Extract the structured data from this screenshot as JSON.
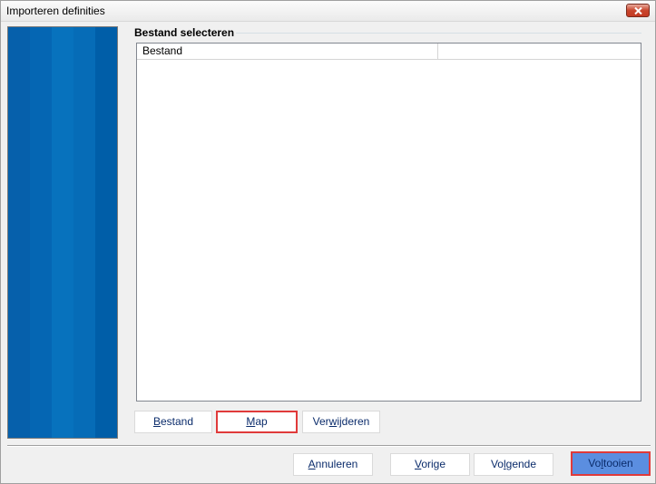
{
  "window": {
    "title": "Importeren definities"
  },
  "group": {
    "title": "Bestand selecteren"
  },
  "list": {
    "columns": [
      "Bestand",
      ""
    ]
  },
  "file_buttons": {
    "bestand": {
      "pre": "",
      "key": "B",
      "post": "estand"
    },
    "map": {
      "pre": "",
      "key": "M",
      "post": "ap"
    },
    "verwijderen": {
      "pre": "Ver",
      "key": "w",
      "post": "ijderen"
    }
  },
  "nav_buttons": {
    "annuleren": {
      "pre": "",
      "key": "A",
      "post": "nnuleren"
    },
    "vorige": {
      "pre": "",
      "key": "V",
      "post": "orige"
    },
    "volgende": {
      "pre": "Vo",
      "key": "l",
      "post": "gende"
    },
    "voltooien": {
      "pre": "Vo",
      "key": "l",
      "post": "tooien"
    }
  },
  "colors": {
    "sidebar": "#005ea8",
    "accent": "#5b8ee0",
    "highlight": "#e03a3a"
  }
}
